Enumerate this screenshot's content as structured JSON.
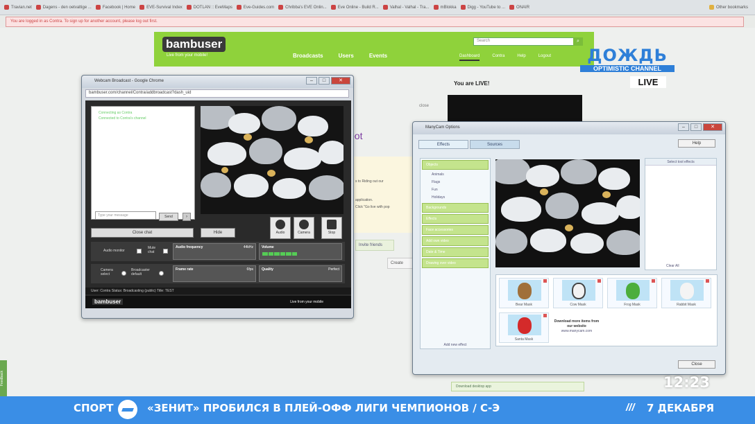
{
  "browser": {
    "bookmarks": [
      "Travian.net",
      "Dagens - den oetvaltige ...",
      "Facebook | Home",
      "EVE-Survival Index",
      "DOTLAN :: EveMaps",
      "Eve-Guides.com",
      "Chribba's EVE Onlin...",
      "Eve Online - Build R...",
      "Valhal - Valhal - Tra...",
      "mBlokka",
      "Digg - YouTube to ...",
      "ONAIR"
    ],
    "other_bookmarks": "Other bookmarks",
    "notice": "You are logged in as Contra. To sign up for another account, please log out first."
  },
  "bambuser": {
    "logo": "bambuser",
    "tagline": "Live from your mobile!",
    "nav": [
      "Broadcasts",
      "Users",
      "Events"
    ],
    "nav_right": [
      "Dashboard",
      "Contra",
      "Help",
      "Logout"
    ],
    "search_placeholder": "Search",
    "live_text": "You are LIVE!",
    "close_text": "close",
    "heading_fragment": "oot",
    "line1": "s to Riding out our",
    "line2": "application.",
    "line3": "Click \"Go live with pop",
    "invite": "Invite friends",
    "create": "Create",
    "download": "Download desktop app",
    "side_tab": "Feedback"
  },
  "webcam_window": {
    "title": "Webcam Broadcast - Google Chrome",
    "address": "bambuser.com/channel/Contra/addbroadcast?dash_uid",
    "chat_lines": [
      "Connecting as Contra",
      "Connected to Contra's channel"
    ],
    "chat_placeholder": "Type your message",
    "send": "Send",
    "close_chat": "Close chat",
    "hide": "Hide",
    "audio": "Audio",
    "camera": "Camera",
    "stop": "Stop",
    "audio_monitor": "Audio monitor",
    "mute_chat": "Mute chat",
    "camera_select": "Camera select",
    "broadcaster_default": "Broadcaster default",
    "audio_frequency": "Audio frequency",
    "audio_frequency_val": "44kHz",
    "volume": "Volume",
    "frame_rate": "Frame rate",
    "frame_rate_val": "6fps",
    "quality": "Quality",
    "quality_val": "Perfect",
    "status": "User: Contra  Status: Broadcasting (public)  Title: TEST",
    "footer_logo": "bambuser",
    "footer_tag": "Live from your mobile"
  },
  "manycam": {
    "title": "ManyCam Options",
    "tabs": [
      "Effects",
      "Sources"
    ],
    "help": "Help",
    "categories": [
      "Objects",
      "Backgrounds",
      "Effects",
      "Face accessories",
      "Add own video",
      "Date & Time",
      "Drawing over video"
    ],
    "object_items": [
      "Animals",
      "Flags",
      "Fun",
      "Holidays"
    ],
    "add_effect": "Add new effect",
    "right_header": "Select tool effects",
    "clear_all": "Clear All",
    "masks": [
      "Bear Mask",
      "Cow Mask",
      "Frog Mask",
      "Rabbit Mask",
      "Santa Mask"
    ],
    "download_more": "Download more items from our website",
    "download_url": "www.manycam.com",
    "close": "Close"
  },
  "tv": {
    "channel_name": "ДОЖДЬ",
    "channel_tagline": "OPTIMISTIC CHANNEL",
    "live": "LIVE",
    "clock": "12:23",
    "ticker_category": "СПОРТ",
    "ticker_headline": "«ЗЕНИТ» ПРОБИЛСЯ В ПЛЕЙ-ОФФ ЛИГИ ЧЕМПИОНОВ / С-Э",
    "ticker_slash": "///",
    "ticker_date": "7 ДЕКАБРЯ",
    "accent": "#3a8ee6"
  }
}
